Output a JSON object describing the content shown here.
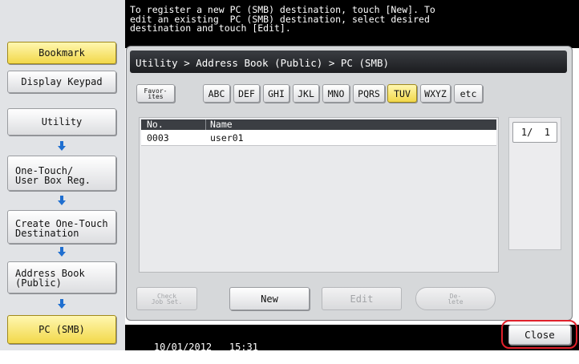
{
  "message": {
    "line1": "To register a new PC (SMB) destination, touch [New]. To",
    "line2": "edit an existing  PC (SMB) destination, select desired",
    "line3": "destination and touch [Edit]."
  },
  "breadcrumb": "Utility > Address Book (Public) > PC (SMB)",
  "left_nav": {
    "bookmark": "Bookmark",
    "display_keypad": "Display Keypad",
    "utility": "Utility",
    "one_touch_line1": "One-Touch/",
    "one_touch_line2": "User Box Reg.",
    "create_line1": "Create One-Touch",
    "create_line2": "Destination",
    "address_line1": "Address Book",
    "address_line2": "(Public)",
    "pc_smb": "PC (SMB)"
  },
  "index_tabs": {
    "favorites_line1": "Favor-",
    "favorites_line2": "ites",
    "tabs": [
      "ABC",
      "DEF",
      "GHI",
      "JKL",
      "MNO",
      "PQRS",
      "TUV",
      "WXYZ",
      "etc"
    ],
    "selected": "TUV"
  },
  "list": {
    "headers": {
      "no": "No.",
      "name": "Name"
    },
    "rows": [
      {
        "no": "0003",
        "name": "user01"
      }
    ]
  },
  "pager": {
    "text": "1/  1"
  },
  "actions": {
    "check_line1": "Check",
    "check_line2": "Job Set.",
    "new": "New",
    "edit": "Edit",
    "delete_line1": "De-",
    "delete_line2": "lete"
  },
  "status": {
    "date": "10/01/2012",
    "time": "15:31"
  },
  "close": "Close",
  "colors": {
    "accent_yellow": "#f2d84a",
    "highlight_red": "#e0202a",
    "arrow_blue": "#1f6fd0"
  }
}
